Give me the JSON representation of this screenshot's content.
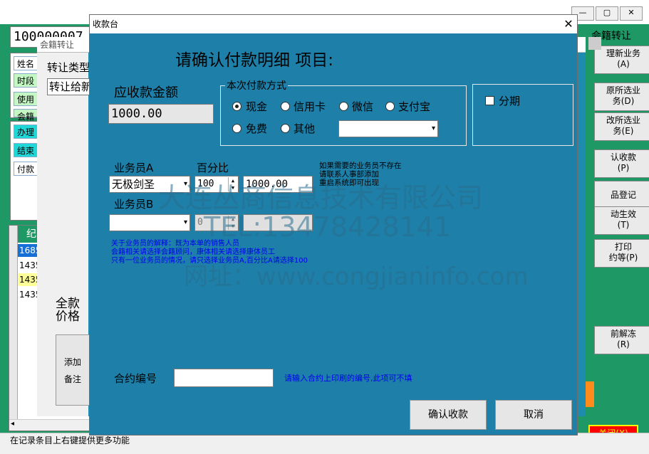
{
  "main": {
    "member_id": "100000007",
    "right_title": "会籍转让",
    "window_buttons": {
      "minimize": "—",
      "maximize": "▢",
      "close": "✕"
    },
    "left_labels": [
      "姓名",
      "时段",
      "使用",
      "会籍"
    ],
    "left_teal_rows": [
      "办理",
      "结束",
      "付款"
    ],
    "grid": {
      "header": "纪录",
      "rows": [
        {
          "value": "1685",
          "style": "selected"
        },
        {
          "value": "1435",
          "style": "normal"
        },
        {
          "value": "1435",
          "style": "yellow"
        },
        {
          "value": "1435",
          "style": "normal"
        }
      ]
    },
    "status_text": "在记录条目上右键提供更多功能",
    "right_buttons": [
      "理新业务\n(A)",
      "原所选业\n务(D)",
      "改所选业\n务(E)",
      "认收款\n(P)",
      "品登记",
      "动生效\n(T)",
      "打印\n约等(P)",
      "前解冻\n(R)"
    ],
    "close_label": "关闭(X)"
  },
  "mid": {
    "title": "会籍转让",
    "transfer_type_label": "转让类型",
    "transfer_to": "转让给新",
    "full_price": "全款\n价格",
    "add_note": "添加\n备注"
  },
  "dialog": {
    "title": "收款台",
    "close_icon": "✕",
    "heading": "请确认付款明细 项目:",
    "amount_label": "应收款金额",
    "amount_value": "1000.00",
    "payment_group_label": "本次付款方式",
    "payment_methods": [
      {
        "label": "现金",
        "checked": true
      },
      {
        "label": "信用卡",
        "checked": false
      },
      {
        "label": "微信",
        "checked": false
      },
      {
        "label": "支付宝",
        "checked": false
      },
      {
        "label": "免费",
        "checked": false
      },
      {
        "label": "其他",
        "checked": false
      }
    ],
    "installment_label": "分期",
    "staff_a_label": "业务员A",
    "percent_label": "百分比",
    "staff_a_value": "无极剑圣",
    "percent_a_value": "100",
    "amount_a_value": "1000.00",
    "staff_b_label": "业务员B",
    "percent_b_value": "0",
    "amount_b_value": "",
    "notice_lines": [
      "如果需要的业务员不存在",
      "请联系人事部添加",
      "重启系统即可出现"
    ],
    "help_lines": [
      "关于业务员的解释：既为本单的销售人员",
      "会籍相关请选择会籍顾问，康体相关请选择康体员工",
      "只有一位业务员的情况，请只选择业务员A,百分比A请选择100"
    ],
    "contract_label": "合约编号",
    "contract_value": "",
    "contract_hint": "请输入合约上印刷的编号,此项可不填",
    "confirm_label": "确认收款",
    "cancel_label": "取消"
  },
  "watermark": {
    "line1": "大连丛商信息技术有限公司",
    "line2": "TEL:13478428141",
    "line3": "网址：www.congjianinfo.com"
  }
}
